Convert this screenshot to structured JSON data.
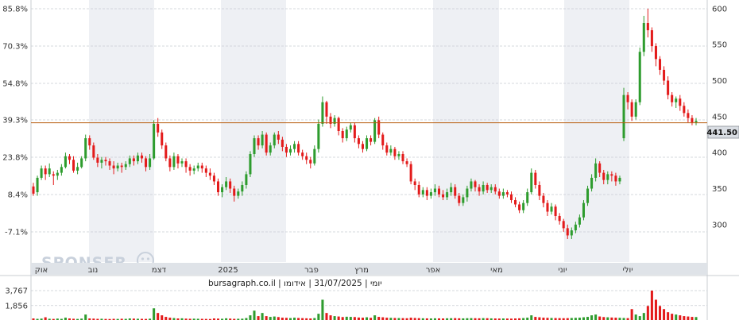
{
  "chart_data": {
    "type": "candlestick",
    "left_axis_ticks": [
      "85.8%",
      "70.3%",
      "54.8%",
      "39.3%",
      "23.8%",
      "8.4%",
      "-7.1%"
    ],
    "right_axis_ticks": [
      600,
      550,
      500,
      450,
      400,
      350,
      300
    ],
    "x_labels": [
      "אוק",
      "נוב",
      "דצמ",
      "2025",
      "פבר",
      "מרץ",
      "אפר",
      "מאי",
      "יוני",
      "יולי"
    ],
    "ylim": [
      248,
      612
    ],
    "reference_line": 441.5,
    "last_price": "441.50",
    "candles": [
      [
        353,
        343,
        358,
        340
      ],
      [
        345,
        365,
        368,
        340
      ],
      [
        365,
        378,
        382,
        362
      ],
      [
        378,
        370,
        382,
        362
      ],
      [
        370,
        378,
        385,
        366
      ],
      [
        370,
        368,
        374,
        355
      ],
      [
        368,
        372,
        376,
        362
      ],
      [
        372,
        380,
        384,
        368
      ],
      [
        380,
        395,
        400,
        378
      ],
      [
        395,
        390,
        398,
        384
      ],
      [
        390,
        375,
        395,
        372
      ],
      [
        375,
        380,
        386,
        370
      ],
      [
        380,
        392,
        395,
        378
      ],
      [
        392,
        420,
        425,
        388
      ],
      [
        420,
        410,
        424,
        404
      ],
      [
        410,
        393,
        414,
        390
      ],
      [
        393,
        386,
        398,
        380
      ],
      [
        386,
        390,
        394,
        378
      ],
      [
        390,
        388,
        394,
        382
      ],
      [
        388,
        382,
        392,
        376
      ],
      [
        382,
        378,
        388,
        370
      ],
      [
        378,
        382,
        386,
        374
      ],
      [
        382,
        380,
        386,
        372
      ],
      [
        380,
        384,
        388,
        376
      ],
      [
        384,
        392,
        396,
        380
      ],
      [
        392,
        388,
        396,
        382
      ],
      [
        388,
        396,
        400,
        384
      ],
      [
        396,
        392,
        400,
        386
      ],
      [
        392,
        380,
        395,
        374
      ],
      [
        380,
        392,
        398,
        376
      ],
      [
        392,
        440,
        445,
        390
      ],
      [
        440,
        428,
        448,
        422
      ],
      [
        428,
        410,
        432,
        405
      ],
      [
        410,
        392,
        414,
        388
      ],
      [
        392,
        380,
        396,
        374
      ],
      [
        380,
        395,
        400,
        376
      ],
      [
        395,
        385,
        398,
        378
      ],
      [
        385,
        388,
        392,
        380
      ],
      [
        388,
        380,
        392,
        372
      ],
      [
        380,
        375,
        384,
        368
      ],
      [
        375,
        378,
        382,
        370
      ],
      [
        378,
        382,
        386,
        374
      ],
      [
        382,
        378,
        386,
        372
      ],
      [
        378,
        372,
        382,
        366
      ],
      [
        372,
        368,
        378,
        362
      ],
      [
        368,
        360,
        372,
        355
      ],
      [
        360,
        345,
        364,
        340
      ],
      [
        345,
        352,
        356,
        338
      ],
      [
        352,
        360,
        366,
        348
      ],
      [
        360,
        350,
        364,
        344
      ],
      [
        350,
        340,
        354,
        332
      ],
      [
        340,
        346,
        350,
        336
      ],
      [
        346,
        355,
        360,
        340
      ],
      [
        355,
        370,
        374,
        350
      ],
      [
        370,
        398,
        402,
        366
      ],
      [
        398,
        420,
        424,
        394
      ],
      [
        420,
        410,
        424,
        404
      ],
      [
        410,
        425,
        430,
        406
      ],
      [
        425,
        400,
        428,
        396
      ],
      [
        400,
        410,
        414,
        396
      ],
      [
        410,
        425,
        428,
        406
      ],
      [
        425,
        418,
        430,
        412
      ],
      [
        418,
        408,
        422,
        402
      ],
      [
        408,
        400,
        412,
        394
      ],
      [
        400,
        405,
        410,
        396
      ],
      [
        405,
        412,
        416,
        400
      ],
      [
        412,
        400,
        416,
        396
      ],
      [
        400,
        395,
        404,
        390
      ],
      [
        395,
        390,
        400,
        384
      ],
      [
        390,
        385,
        394,
        378
      ],
      [
        385,
        405,
        410,
        382
      ],
      [
        405,
        440,
        446,
        400
      ],
      [
        440,
        470,
        478,
        436
      ],
      [
        470,
        450,
        472,
        440
      ],
      [
        450,
        440,
        455,
        434
      ],
      [
        440,
        448,
        452,
        436
      ],
      [
        448,
        430,
        450,
        424
      ],
      [
        430,
        420,
        434,
        414
      ],
      [
        420,
        432,
        436,
        416
      ],
      [
        432,
        438,
        442,
        428
      ],
      [
        438,
        420,
        442,
        414
      ],
      [
        420,
        412,
        424,
        406
      ],
      [
        412,
        405,
        416,
        400
      ],
      [
        405,
        420,
        424,
        402
      ],
      [
        420,
        415,
        424,
        410
      ],
      [
        415,
        445,
        448,
        412
      ],
      [
        445,
        425,
        450,
        420
      ],
      [
        425,
        410,
        428,
        404
      ],
      [
        410,
        400,
        414,
        396
      ],
      [
        400,
        405,
        410,
        396
      ],
      [
        405,
        395,
        408,
        390
      ],
      [
        395,
        398,
        402,
        390
      ],
      [
        398,
        388,
        402,
        384
      ],
      [
        388,
        384,
        392,
        380
      ],
      [
        384,
        360,
        388,
        356
      ],
      [
        360,
        355,
        364,
        348
      ],
      [
        355,
        342,
        360,
        338
      ],
      [
        342,
        348,
        352,
        338
      ],
      [
        348,
        340,
        352,
        334
      ],
      [
        340,
        345,
        350,
        336
      ],
      [
        345,
        350,
        356,
        340
      ],
      [
        350,
        342,
        354,
        338
      ],
      [
        342,
        338,
        348,
        334
      ],
      [
        338,
        345,
        350,
        334
      ],
      [
        345,
        352,
        358,
        340
      ],
      [
        352,
        340,
        356,
        336
      ],
      [
        340,
        330,
        344,
        326
      ],
      [
        330,
        338,
        342,
        326
      ],
      [
        338,
        350,
        354,
        332
      ],
      [
        350,
        360,
        364,
        346
      ],
      [
        360,
        352,
        362,
        346
      ],
      [
        352,
        346,
        356,
        340
      ],
      [
        346,
        355,
        360,
        342
      ],
      [
        355,
        348,
        358,
        344
      ],
      [
        348,
        352,
        356,
        344
      ],
      [
        352,
        346,
        356,
        342
      ],
      [
        346,
        340,
        350,
        336
      ],
      [
        340,
        345,
        350,
        336
      ],
      [
        345,
        342,
        348,
        338
      ],
      [
        342,
        334,
        346,
        330
      ],
      [
        334,
        328,
        338,
        324
      ],
      [
        328,
        320,
        332,
        316
      ],
      [
        320,
        330,
        334,
        316
      ],
      [
        330,
        345,
        350,
        326
      ],
      [
        345,
        372,
        378,
        342
      ],
      [
        372,
        355,
        376,
        350
      ],
      [
        355,
        340,
        360,
        334
      ],
      [
        340,
        330,
        344,
        324
      ],
      [
        330,
        318,
        334,
        312
      ],
      [
        318,
        325,
        330,
        314
      ],
      [
        325,
        312,
        328,
        306
      ],
      [
        312,
        305,
        316,
        300
      ],
      [
        305,
        295,
        308,
        290
      ],
      [
        295,
        285,
        300,
        280
      ],
      [
        285,
        292,
        296,
        280
      ],
      [
        292,
        300,
        304,
        288
      ],
      [
        300,
        310,
        314,
        296
      ],
      [
        310,
        330,
        334,
        306
      ],
      [
        330,
        350,
        354,
        326
      ],
      [
        350,
        365,
        370,
        346
      ],
      [
        365,
        385,
        392,
        360
      ],
      [
        385,
        372,
        388,
        366
      ],
      [
        372,
        362,
        376,
        356
      ],
      [
        362,
        370,
        374,
        356
      ],
      [
        370,
        368,
        374,
        360
      ],
      [
        368,
        360,
        372,
        354
      ],
      [
        360,
        365,
        368,
        356
      ],
      [
        420,
        480,
        490,
        416
      ],
      [
        480,
        470,
        484,
        460
      ],
      [
        470,
        450,
        474,
        444
      ],
      [
        450,
        470,
        474,
        446
      ],
      [
        470,
        540,
        546,
        466
      ],
      [
        540,
        580,
        590,
        534
      ],
      [
        580,
        570,
        600,
        560
      ],
      [
        570,
        548,
        574,
        540
      ],
      [
        548,
        530,
        552,
        520
      ],
      [
        530,
        515,
        534,
        508
      ],
      [
        515,
        500,
        520,
        494
      ],
      [
        500,
        480,
        506,
        474
      ],
      [
        480,
        470,
        484,
        464
      ],
      [
        470,
        475,
        478,
        462
      ],
      [
        475,
        465,
        480,
        458
      ],
      [
        465,
        455,
        470,
        450
      ],
      [
        455,
        448,
        460,
        442
      ],
      [
        448,
        442,
        452,
        438
      ],
      [
        442,
        444,
        448,
        438
      ]
    ],
    "volume_ticks": [
      "3,767",
      "1,856"
    ],
    "volumes": [
      200,
      150,
      180,
      350,
      160,
      140,
      180,
      150,
      300,
      200,
      160,
      140,
      180,
      700,
      200,
      180,
      150,
      160,
      140,
      130,
      150,
      140,
      160,
      150,
      200,
      180,
      160,
      150,
      140,
      170,
      1500,
      900,
      600,
      400,
      300,
      250,
      200,
      220,
      180,
      160,
      170,
      160,
      150,
      140,
      130,
      200,
      180,
      160,
      220,
      180,
      150,
      160,
      170,
      250,
      600,
      1200,
      500,
      900,
      500,
      400,
      450,
      380,
      300,
      280,
      250,
      300,
      260,
      240,
      220,
      200,
      250,
      800,
      2600,
      900,
      600,
      500,
      450,
      380,
      420,
      400,
      380,
      320,
      300,
      350,
      280,
      600,
      400,
      350,
      300,
      280,
      260,
      250,
      240,
      230,
      300,
      260,
      240,
      220,
      210,
      200,
      220,
      210,
      200,
      220,
      230,
      240,
      220,
      210,
      230,
      240,
      230,
      220,
      240,
      230,
      210,
      200,
      190,
      200,
      190,
      180,
      200,
      220,
      250,
      300,
      600,
      400,
      350,
      300,
      280,
      260,
      250,
      240,
      230,
      240,
      260,
      280,
      300,
      350,
      400,
      600,
      700,
      450,
      380,
      350,
      320,
      300,
      280,
      260,
      240,
      1400,
      700,
      500,
      900,
      1800,
      3767,
      2600,
      1800,
      1400,
      1000,
      800,
      700,
      600,
      500,
      450,
      400,
      380,
      350,
      300
    ],
    "vol_max": 3767
  },
  "header": {
    "info_text": "יומי | 31/07/2025 | אידומו | bursagraph.co.il",
    "watermark": "SPONSER"
  },
  "colors": {
    "up": "#2e9c2e",
    "down": "#e31b1b",
    "ref_line": "#b85e10",
    "grid": "#c8ccd2",
    "band": "#eef0f4"
  }
}
